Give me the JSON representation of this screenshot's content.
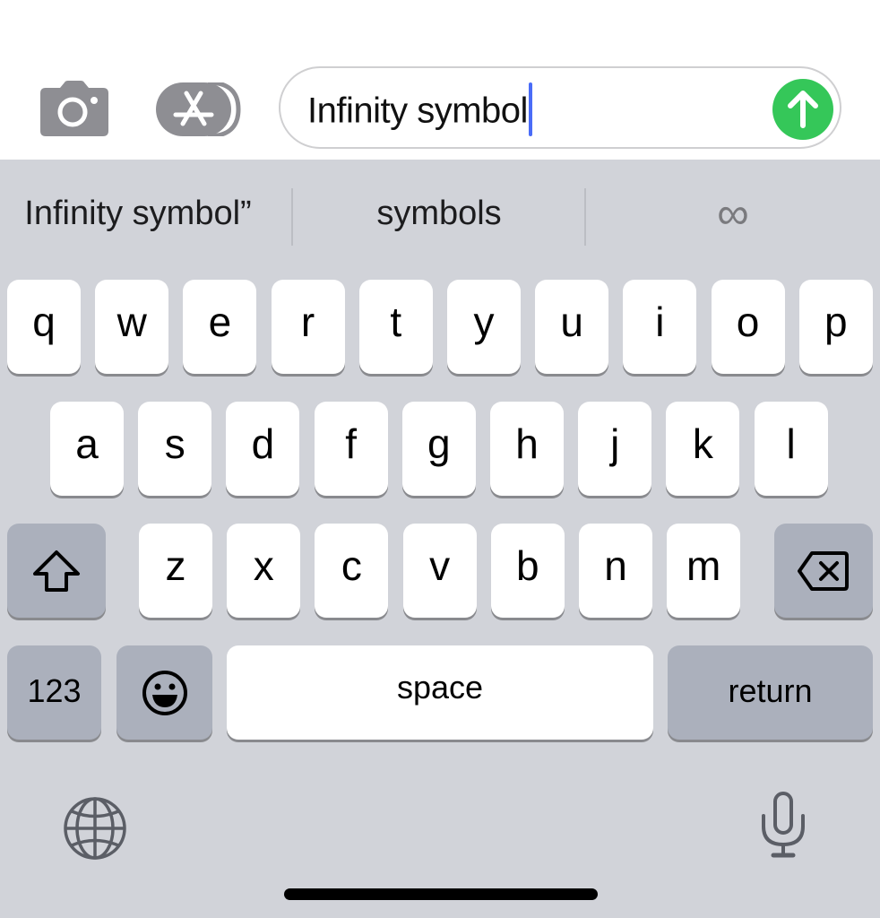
{
  "toolbar": {
    "camera_icon": "camera-icon",
    "appstore_icon": "app-store-icon"
  },
  "message_input": {
    "value": "Infinity symbol",
    "send_icon": "arrow-up-icon",
    "colors": {
      "send_button": "#35c759",
      "caret": "#4a6cf7"
    }
  },
  "suggestions": [
    {
      "label": "Infinity symbol”"
    },
    {
      "label": "symbols"
    },
    {
      "label": "∞"
    }
  ],
  "keyboard": {
    "row1": [
      "q",
      "w",
      "e",
      "r",
      "t",
      "y",
      "u",
      "i",
      "o",
      "p"
    ],
    "row2": [
      "a",
      "s",
      "d",
      "f",
      "g",
      "h",
      "j",
      "k",
      "l"
    ],
    "row3": [
      "z",
      "x",
      "c",
      "v",
      "b",
      "n",
      "m"
    ],
    "shift_icon": "shift-icon",
    "backspace_icon": "backspace-icon",
    "numbers_label": "123",
    "emoji_icon": "emoji-icon",
    "space_label": "space",
    "return_label": "return",
    "globe_icon": "globe-icon",
    "mic_icon": "microphone-icon",
    "colors": {
      "background": "#d1d3d9",
      "key": "#ffffff",
      "function_key": "#abb0bc"
    }
  }
}
